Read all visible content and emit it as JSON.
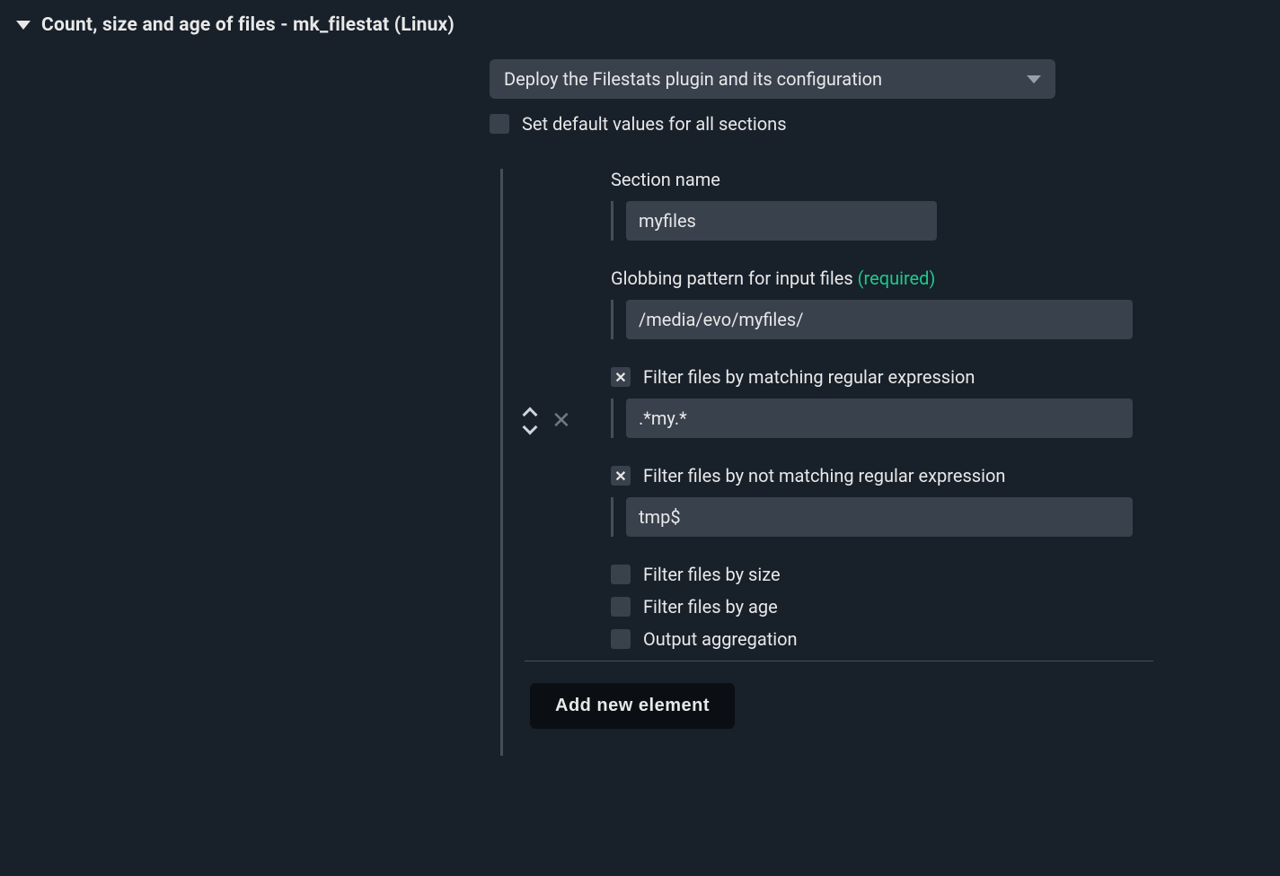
{
  "header": {
    "title": "Count, size and age of files - mk_filestat (Linux)"
  },
  "dropdown": {
    "selected": "Deploy the Filestats plugin and its configuration"
  },
  "defaults_checkbox": {
    "label": "Set default values for all sections"
  },
  "section": {
    "section_name_label": "Section name",
    "section_name_value": "myfiles",
    "glob_label": "Globbing pattern for input files",
    "required_text": "(required)",
    "glob_value": "/media/evo/myfiles/",
    "filter_match_label": "Filter files by matching regular expression",
    "filter_match_value": ".*my.*",
    "filter_notmatch_label": "Filter files by not matching regular expression",
    "filter_notmatch_value": "tmp$",
    "filter_size_label": "Filter files by size",
    "filter_age_label": "Filter files by age",
    "output_agg_label": "Output aggregation"
  },
  "add_button": {
    "label": "Add new element"
  }
}
